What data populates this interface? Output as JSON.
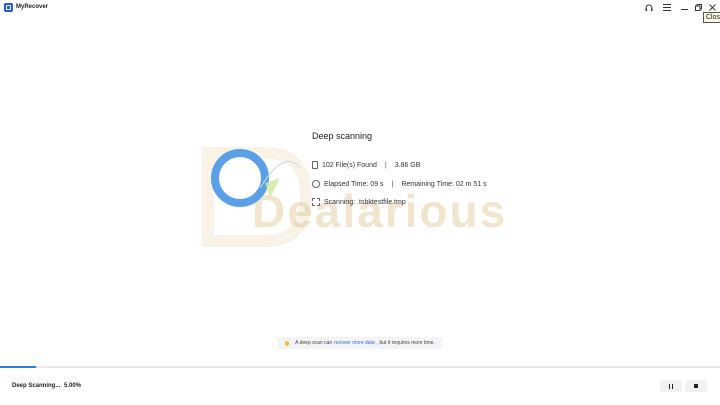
{
  "window": {
    "title": "MyRecover",
    "tooltip": "Close"
  },
  "watermark": {
    "text": "Dealarious"
  },
  "scan": {
    "title": "Deep scanning",
    "files_found": "102 File(s) Found",
    "size": "3.86 GB",
    "elapsed": "Elapsed Time: 09 s",
    "remaining": "Remaining Time: 02 m 51 s",
    "current_file": "Scanning: .tsbktestfile.tmp",
    "separator": "|"
  },
  "tip": {
    "prefix": "A deep scan can",
    "link": "recover more data",
    "suffix": ", but it requires more time."
  },
  "footer": {
    "status": "Deep Scanning...",
    "percent": "5.00%",
    "progress_fraction": 0.05
  },
  "colors": {
    "accent": "#2f7bd9",
    "ring": "#5aa0e6",
    "brand": "#1f5fd1"
  }
}
